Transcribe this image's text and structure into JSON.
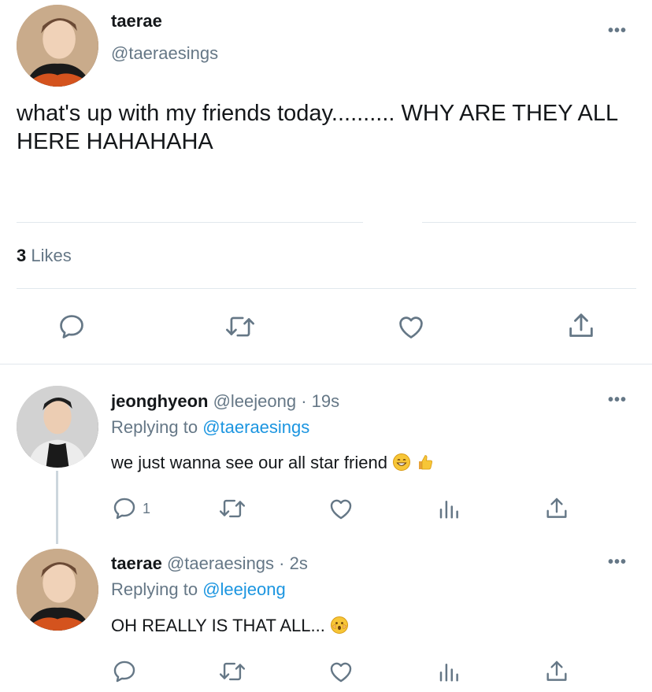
{
  "main_tweet": {
    "name": "taerae",
    "handle": "@taeraesings",
    "text": "what's up with my friends today.......... WHY ARE THEY ALL HERE HAHAHAHA",
    "likes_count": "3",
    "likes_label": "Likes"
  },
  "replies": [
    {
      "name": "jeonghyeon",
      "handle": "@leejeong",
      "time": "· 19s",
      "replying_prefix": "Replying to",
      "replying_to": "@taeraesings",
      "text": "we just wanna see our all star friend",
      "reply_count": "1",
      "emojis": [
        "grinning-face",
        "thumbs-up"
      ]
    },
    {
      "name": "taerae",
      "handle": "@taeraesings",
      "time": "· 2s",
      "replying_prefix": "Replying to",
      "replying_to": "@leejeong",
      "text": "OH REALLY IS THAT ALL...",
      "reply_count": "",
      "emojis": [
        "shocked-face"
      ]
    }
  ],
  "colors": {
    "text": "#14171a",
    "muted": "#657786",
    "link": "#1b95e0",
    "divider": "#e1e8ed",
    "icon": "#657786"
  },
  "icons": [
    "more-icon",
    "reply-icon",
    "retweet-icon",
    "like-icon",
    "share-icon",
    "analytics-icon"
  ]
}
